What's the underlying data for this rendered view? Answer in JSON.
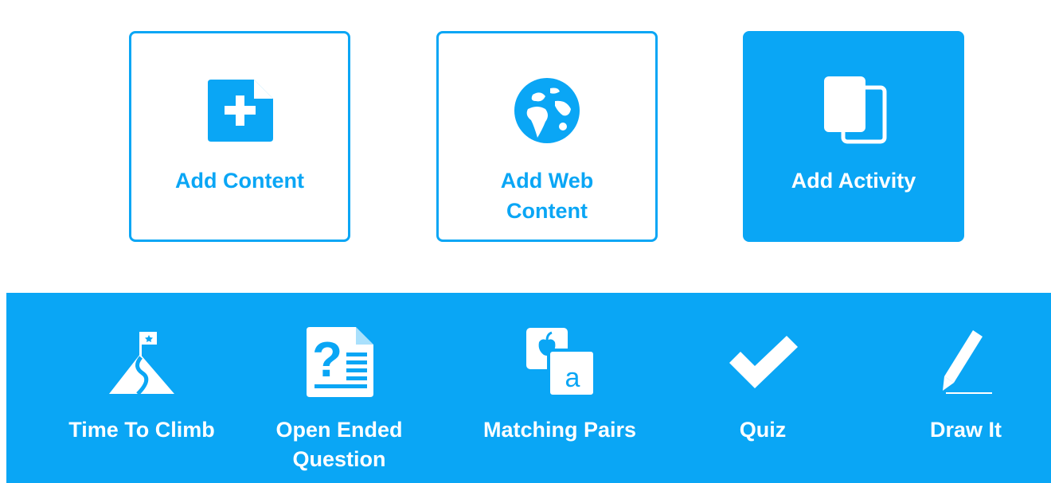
{
  "cards": {
    "add_content": {
      "label": "Add Content",
      "icon": "add-file-icon"
    },
    "add_web_content": {
      "label": "Add Web\nContent",
      "icon": "globe-icon"
    },
    "add_activity": {
      "label": "Add Activity",
      "icon": "copy-pages-icon",
      "active": true
    }
  },
  "activities": {
    "time_to_climb": {
      "label": "Time To Climb",
      "icon": "mountain-flag-icon"
    },
    "open_ended": {
      "label": "Open Ended\nQuestion",
      "icon": "question-document-icon"
    },
    "matching_pairs": {
      "label": "Matching Pairs",
      "icon": "matching-cards-icon",
      "card_letter": "a"
    },
    "quiz": {
      "label": "Quiz",
      "icon": "checkmark-icon"
    },
    "draw_it": {
      "label": "Draw It",
      "icon": "pencil-icon"
    }
  },
  "colors": {
    "accent": "#0aa6f5",
    "background": "#ffffff",
    "on_accent": "#ffffff"
  }
}
